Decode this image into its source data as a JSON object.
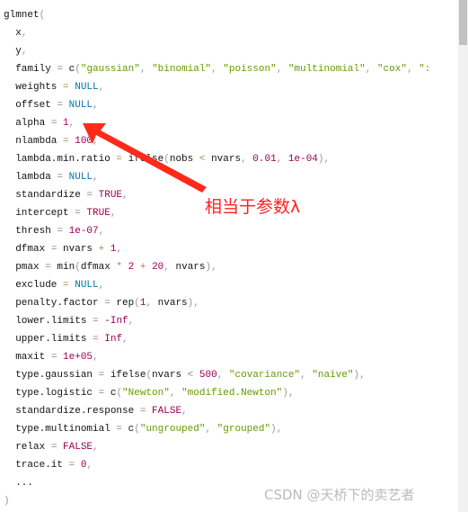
{
  "code_lines": [
    [
      [
        "p",
        "glmnet"
      ],
      [
        "u",
        "("
      ]
    ],
    [
      [
        "p",
        "  x"
      ],
      [
        "u",
        ","
      ]
    ],
    [
      [
        "p",
        "  y"
      ],
      [
        "u",
        ","
      ]
    ],
    [
      [
        "p",
        "  family "
      ],
      [
        "o",
        "="
      ],
      [
        "p",
        " c"
      ],
      [
        "u",
        "("
      ],
      [
        "s",
        "\"gaussian\""
      ],
      [
        "u",
        ", "
      ],
      [
        "s",
        "\"binomial\""
      ],
      [
        "u",
        ", "
      ],
      [
        "s",
        "\"poisson\""
      ],
      [
        "u",
        ", "
      ],
      [
        "s",
        "\"multinomial\""
      ],
      [
        "u",
        ", "
      ],
      [
        "s",
        "\"cox\""
      ],
      [
        "u",
        ", "
      ],
      [
        "s",
        "\":"
      ]
    ],
    [
      [
        "p",
        "  weights "
      ],
      [
        "o",
        "="
      ],
      [
        "k",
        " NULL"
      ],
      [
        "u",
        ","
      ]
    ],
    [
      [
        "p",
        "  offset "
      ],
      [
        "o",
        "="
      ],
      [
        "k",
        " NULL"
      ],
      [
        "u",
        ","
      ]
    ],
    [
      [
        "p",
        "  alpha "
      ],
      [
        "o",
        "="
      ],
      [
        "n",
        " 1"
      ],
      [
        "u",
        ","
      ]
    ],
    [
      [
        "p",
        "  nlambda "
      ],
      [
        "o",
        "="
      ],
      [
        "n",
        " 100"
      ],
      [
        "u",
        ","
      ]
    ],
    [
      [
        "p",
        "  lambda.min.ratio "
      ],
      [
        "o",
        "="
      ],
      [
        "p",
        " ifelse"
      ],
      [
        "u",
        "("
      ],
      [
        "p",
        "nobs "
      ],
      [
        "o",
        "<"
      ],
      [
        "p",
        " nvars"
      ],
      [
        "u",
        ", "
      ],
      [
        "n",
        "0.01"
      ],
      [
        "u",
        ", "
      ],
      [
        "n",
        "1e-04"
      ],
      [
        "u",
        "),"
      ]
    ],
    [
      [
        "p",
        "  lambda "
      ],
      [
        "o",
        "="
      ],
      [
        "k",
        " NULL"
      ],
      [
        "u",
        ","
      ]
    ],
    [
      [
        "p",
        "  standardize "
      ],
      [
        "o",
        "="
      ],
      [
        "n",
        " TRUE"
      ],
      [
        "u",
        ","
      ]
    ],
    [
      [
        "p",
        "  intercept "
      ],
      [
        "o",
        "="
      ],
      [
        "n",
        " TRUE"
      ],
      [
        "u",
        ","
      ]
    ],
    [
      [
        "p",
        "  thresh "
      ],
      [
        "o",
        "="
      ],
      [
        "n",
        " 1e-07"
      ],
      [
        "u",
        ","
      ]
    ],
    [
      [
        "p",
        "  dfmax "
      ],
      [
        "o",
        "="
      ],
      [
        "p",
        " nvars "
      ],
      [
        "o",
        "+"
      ],
      [
        "n",
        " 1"
      ],
      [
        "u",
        ","
      ]
    ],
    [
      [
        "p",
        "  pmax "
      ],
      [
        "o",
        "="
      ],
      [
        "p",
        " min"
      ],
      [
        "u",
        "("
      ],
      [
        "p",
        "dfmax "
      ],
      [
        "o",
        "*"
      ],
      [
        "n",
        " 2 "
      ],
      [
        "o",
        "+"
      ],
      [
        "n",
        " 20"
      ],
      [
        "u",
        ", "
      ],
      [
        "p",
        "nvars"
      ],
      [
        "u",
        "),"
      ]
    ],
    [
      [
        "p",
        "  exclude "
      ],
      [
        "o",
        "="
      ],
      [
        "k",
        " NULL"
      ],
      [
        "u",
        ","
      ]
    ],
    [
      [
        "p",
        "  penalty.factor "
      ],
      [
        "o",
        "="
      ],
      [
        "p",
        " rep"
      ],
      [
        "u",
        "("
      ],
      [
        "n",
        "1"
      ],
      [
        "u",
        ", "
      ],
      [
        "p",
        "nvars"
      ],
      [
        "u",
        "),"
      ]
    ],
    [
      [
        "p",
        "  lower.limits "
      ],
      [
        "o",
        "="
      ],
      [
        "n",
        " -Inf"
      ],
      [
        "u",
        ","
      ]
    ],
    [
      [
        "p",
        "  upper.limits "
      ],
      [
        "o",
        "="
      ],
      [
        "n",
        " Inf"
      ],
      [
        "u",
        ","
      ]
    ],
    [
      [
        "p",
        "  maxit "
      ],
      [
        "o",
        "="
      ],
      [
        "n",
        " 1e+05"
      ],
      [
        "u",
        ","
      ]
    ],
    [
      [
        "p",
        "  type.gaussian "
      ],
      [
        "o",
        "="
      ],
      [
        "p",
        " ifelse"
      ],
      [
        "u",
        "("
      ],
      [
        "p",
        "nvars "
      ],
      [
        "o",
        "<"
      ],
      [
        "n",
        " 500"
      ],
      [
        "u",
        ", "
      ],
      [
        "s",
        "\"covariance\""
      ],
      [
        "u",
        ", "
      ],
      [
        "s",
        "\"naive\""
      ],
      [
        "u",
        "),"
      ]
    ],
    [
      [
        "p",
        "  type.logistic "
      ],
      [
        "o",
        "="
      ],
      [
        "p",
        " c"
      ],
      [
        "u",
        "("
      ],
      [
        "s",
        "\"Newton\""
      ],
      [
        "u",
        ", "
      ],
      [
        "s",
        "\"modified.Newton\""
      ],
      [
        "u",
        "),"
      ]
    ],
    [
      [
        "p",
        "  standardize.response "
      ],
      [
        "o",
        "="
      ],
      [
        "n",
        " FALSE"
      ],
      [
        "u",
        ","
      ]
    ],
    [
      [
        "p",
        "  type.multinomial "
      ],
      [
        "o",
        "="
      ],
      [
        "p",
        " c"
      ],
      [
        "u",
        "("
      ],
      [
        "s",
        "\"ungrouped\""
      ],
      [
        "u",
        ", "
      ],
      [
        "s",
        "\"grouped\""
      ],
      [
        "u",
        "),"
      ]
    ],
    [
      [
        "p",
        "  relax "
      ],
      [
        "o",
        "="
      ],
      [
        "n",
        " FALSE"
      ],
      [
        "u",
        ","
      ]
    ],
    [
      [
        "p",
        "  trace.it "
      ],
      [
        "o",
        "="
      ],
      [
        "n",
        " 0"
      ],
      [
        "u",
        ","
      ]
    ],
    [
      [
        "p",
        "  ..."
      ]
    ],
    [
      [
        "u",
        ")"
      ]
    ]
  ],
  "annotation": "相当于参数λ",
  "watermark": "CSDN @天桥下的卖艺者",
  "colors": {
    "arrow": "#ff2a1a",
    "string": "#669900",
    "keyword": "#0077aa",
    "number": "#990055",
    "operator": "#a67f59"
  }
}
